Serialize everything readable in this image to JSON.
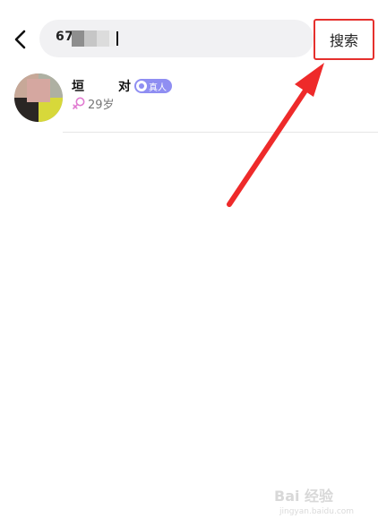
{
  "header": {
    "search_value": "67",
    "search_button_label": "搜索"
  },
  "result": {
    "name_start": "垣",
    "name_end": "对",
    "badge_label": "真人",
    "age": "29岁"
  },
  "watermark": {
    "main": "Bai 经验",
    "sub": "jingyan.baidu.com"
  },
  "colors": {
    "highlight": "#e5302d",
    "badge": "#8f8ef2",
    "female": "#e07ad0"
  }
}
